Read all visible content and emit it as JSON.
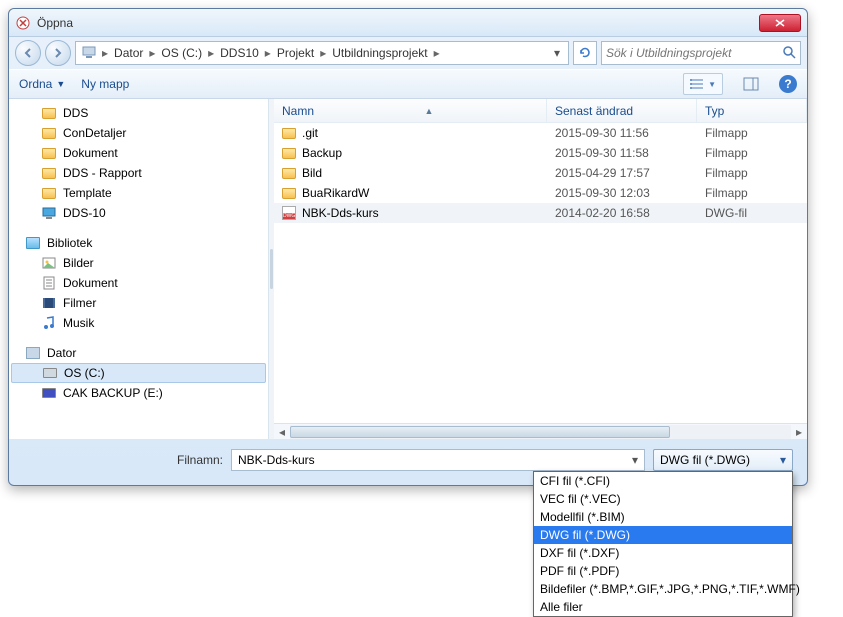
{
  "window": {
    "title": "Öppna"
  },
  "breadcrumb": {
    "segments": [
      "Dator",
      "OS (C:)",
      "DDS10",
      "Projekt",
      "Utbildningsprojekt"
    ]
  },
  "search": {
    "placeholder": "Sök i Utbildningsprojekt"
  },
  "toolbar": {
    "organize": "Ordna",
    "newfolder": "Ny mapp"
  },
  "sidebar": {
    "top_items": [
      {
        "label": "DDS"
      },
      {
        "label": "ConDetaljer"
      },
      {
        "label": "Dokument"
      },
      {
        "label": "DDS - Rapport"
      },
      {
        "label": "Template"
      },
      {
        "label": "DDS-10",
        "icon": "monitor"
      }
    ],
    "lib_label": "Bibliotek",
    "lib_items": [
      {
        "label": "Bilder",
        "icon": "pic"
      },
      {
        "label": "Dokument",
        "icon": "doc"
      },
      {
        "label": "Filmer",
        "icon": "film"
      },
      {
        "label": "Musik",
        "icon": "music"
      }
    ],
    "pc_label": "Dator",
    "pc_items": [
      {
        "label": "OS (C:)",
        "selected": true
      },
      {
        "label": "CAK BACKUP (E:)",
        "ext": true
      }
    ]
  },
  "columns": {
    "name": "Namn",
    "date": "Senast ändrad",
    "type": "Typ"
  },
  "files": [
    {
      "name": ".git",
      "date": "2015-09-30 11:56",
      "type": "Filmapp",
      "kind": "folder"
    },
    {
      "name": "Backup",
      "date": "2015-09-30 11:58",
      "type": "Filmapp",
      "kind": "folder"
    },
    {
      "name": "Bild",
      "date": "2015-04-29 17:57",
      "type": "Filmapp",
      "kind": "folder"
    },
    {
      "name": "BuaRikardW",
      "date": "2015-09-30 12:03",
      "type": "Filmapp",
      "kind": "folder"
    },
    {
      "name": "NBK-Dds-kurs",
      "date": "2014-02-20 16:58",
      "type": "DWG-fil",
      "kind": "dwg",
      "selected": true
    }
  ],
  "bottom": {
    "filename_label": "Filnamn:",
    "filename_value": "NBK-Dds-kurs",
    "filter_selected": "DWG fil (*.DWG)"
  },
  "filter_options": [
    "CFI fil (*.CFI)",
    "VEC fil (*.VEC)",
    "Modellfil (*.BIM)",
    "DWG fil (*.DWG)",
    "DXF fil (*.DXF)",
    "PDF fil (*.PDF)",
    "Bildefiler (*.BMP,*.GIF,*.JPG,*.PNG,*.TIF,*.WMF)",
    "Alle filer"
  ]
}
